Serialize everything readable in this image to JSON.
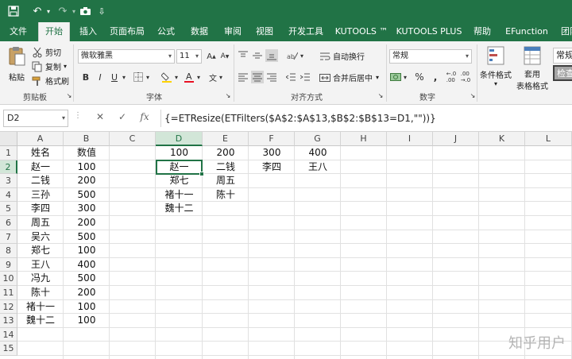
{
  "qat": {
    "save_icon": "save-icon",
    "undo": "↶",
    "redo": "↷",
    "camera_icon": "camera-icon",
    "more": "⇩"
  },
  "tabs": [
    "文件",
    "开始",
    "插入",
    "页面布局",
    "公式",
    "数据",
    "审阅",
    "视图",
    "开发工具",
    "KUTOOLS ™",
    "KUTOOLS PLUS",
    "帮助",
    "EFunction",
    "团队"
  ],
  "ribbon": {
    "paste": "粘贴",
    "cut": "剪切",
    "copy": "复制",
    "format_painter": "格式刷",
    "clipboard_label": "剪贴板",
    "font_name": "微软雅黑",
    "font_size": "11",
    "font_label": "字体",
    "wrap_text": "自动换行",
    "merge_center": "合并后居中",
    "align_label": "对齐方式",
    "number_format": "常规",
    "number_label": "数字",
    "cond_format": "条件格式",
    "table_format_1": "套用",
    "table_format_2": "表格格式",
    "style_normal": "常规",
    "style_check": "检查"
  },
  "formula_bar": {
    "name_box": "D2",
    "formula": "{=ETResize(ETFilters($A$2:$A$13,$B$2:$B$13=D1,\"\"))}"
  },
  "columns": [
    "A",
    "B",
    "C",
    "D",
    "E",
    "F",
    "G",
    "H",
    "I",
    "J",
    "K",
    "L"
  ],
  "rows": [
    "1",
    "2",
    "3",
    "4",
    "5",
    "6",
    "7",
    "8",
    "9",
    "10",
    "11",
    "12",
    "13",
    "14",
    "15"
  ],
  "cells": {
    "A": [
      "姓名",
      "赵一",
      "二钱",
      "三孙",
      "李四",
      "周五",
      "吴六",
      "郑七",
      "王八",
      "冯九",
      "陈十",
      "褚十一",
      "魏十二"
    ],
    "B": [
      "数值",
      "100",
      "200",
      "500",
      "300",
      "200",
      "500",
      "100",
      "400",
      "500",
      "200",
      "100",
      "100"
    ],
    "D": [
      "100",
      "赵一",
      "郑七",
      "褚十一",
      "魏十二"
    ],
    "E": [
      "200",
      "二钱",
      "周五",
      "陈十"
    ],
    "F": [
      "300",
      "李四"
    ],
    "G": [
      "400",
      "王八"
    ]
  },
  "watermark": "知乎用户",
  "colors": {
    "accent": "#217346"
  }
}
